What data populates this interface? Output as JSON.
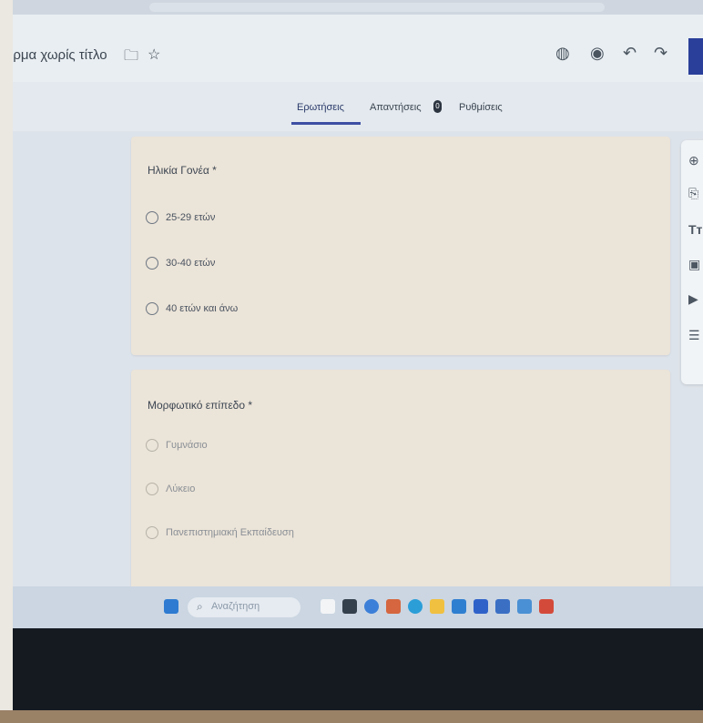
{
  "app": {
    "doc_title": "όρμα χωρίς τίτλο"
  },
  "tabs": [
    {
      "label": "Ερωτήσεις"
    },
    {
      "label": "Απαντήσεις"
    },
    {
      "label": "Ρυθμίσεις"
    }
  ],
  "badge_count": "0",
  "questions": [
    {
      "title": "Ηλικία Γονέα *",
      "options": [
        "25-29 ετών",
        "30-40 ετών",
        "40 ετών και άνω"
      ]
    },
    {
      "title": "Μορφωτικό επίπεδο *",
      "options": [
        "Γυμνάσιο",
        "Λύκειο",
        "Πανεπιστημιακή Εκπαίδευση"
      ]
    }
  ],
  "taskbar": {
    "search_placeholder": "Αναζήτηση"
  },
  "colors": {
    "accent": "#3d4fa3",
    "card_bg": "#ebe4d8",
    "page_bg": "#dde3ea",
    "taskbar": "#cbd6e2"
  },
  "icons": {
    "folder": "folder-icon",
    "star": "star-icon",
    "palette": "palette-icon",
    "preview": "eye-icon",
    "undo": "undo-icon",
    "redo": "redo-icon",
    "side": [
      "add-question-icon",
      "import-icon",
      "title-icon",
      "image-icon",
      "video-icon",
      "section-icon"
    ]
  }
}
